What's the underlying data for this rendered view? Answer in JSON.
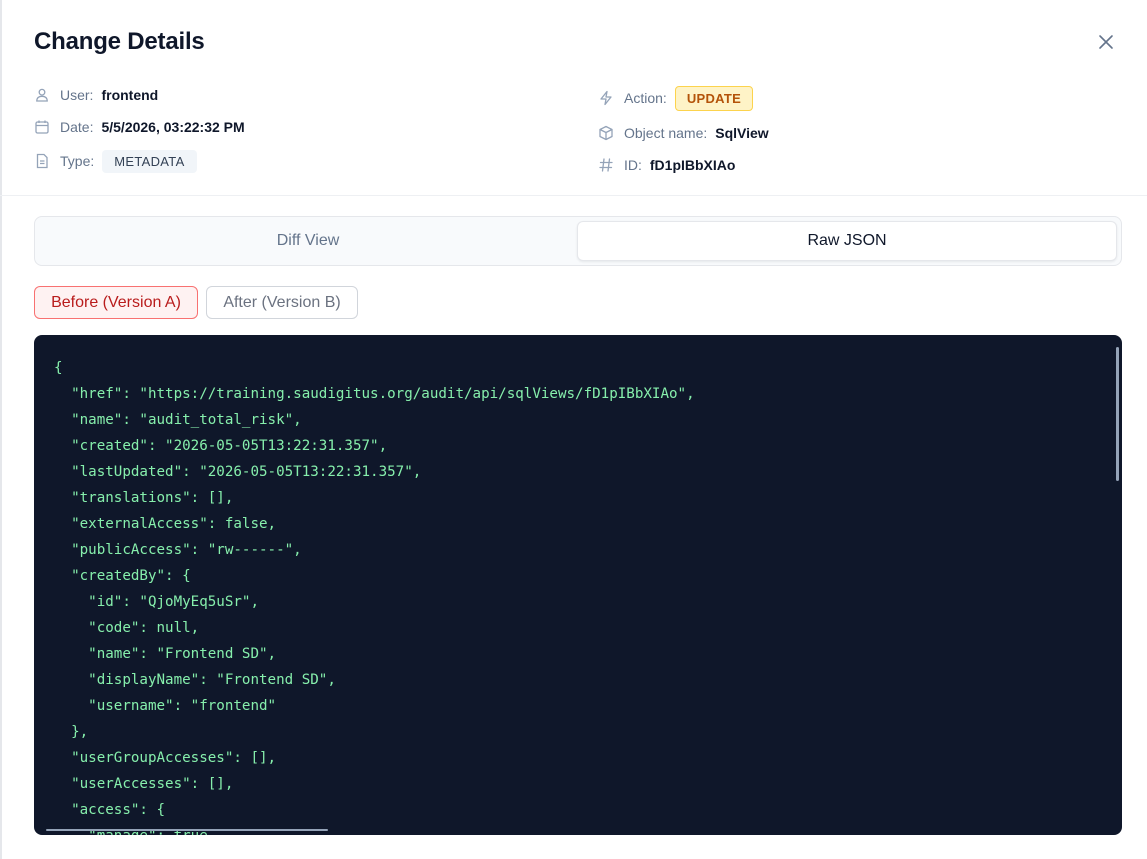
{
  "dialog": {
    "title": "Change Details",
    "close_icon": "x-icon"
  },
  "meta": {
    "user": {
      "label": "User:",
      "value": "frontend",
      "icon": "user-icon"
    },
    "date": {
      "label": "Date:",
      "value": "5/5/2026, 03:22:32 PM",
      "icon": "calendar-icon"
    },
    "type": {
      "label": "Type:",
      "value": "METADATA",
      "icon": "file-icon"
    },
    "action": {
      "label": "Action:",
      "value": "UPDATE",
      "icon": "lightning-icon",
      "color": "#b45309"
    },
    "object_name": {
      "label": "Object name:",
      "value": "SqlView",
      "icon": "cube-icon"
    },
    "id": {
      "label": "ID:",
      "value": "fD1pIBbXIAo",
      "icon": "hash-icon"
    }
  },
  "tabs": [
    {
      "label": "Diff View",
      "active": false
    },
    {
      "label": "Raw JSON",
      "active": true
    }
  ],
  "versions": {
    "before_label": "Before (Version A)",
    "after_label": "After (Version B)",
    "selected": "before"
  },
  "json_lines": [
    "{",
    "  \"href\": \"https://training.saudigitus.org/audit/api/sqlViews/fD1pIBbXIAo\",",
    "  \"name\": \"audit_total_risk\",",
    "  \"created\": \"2026-05-05T13:22:31.357\",",
    "  \"lastUpdated\": \"2026-05-05T13:22:31.357\",",
    "  \"translations\": [],",
    "  \"externalAccess\": false,",
    "  \"publicAccess\": \"rw------\",",
    "  \"createdBy\": {",
    "    \"id\": \"QjoMyEq5uSr\",",
    "    \"code\": null,",
    "    \"name\": \"Frontend SD\",",
    "    \"displayName\": \"Frontend SD\",",
    "    \"username\": \"frontend\"",
    "  },",
    "  \"userGroupAccesses\": [],",
    "  \"userAccesses\": [],",
    "  \"access\": {",
    "    \"manage\": true,"
  ],
  "colors": {
    "code_bg": "#0f172a",
    "code_text": "#86efac",
    "before_accent": "#b91c1c"
  }
}
